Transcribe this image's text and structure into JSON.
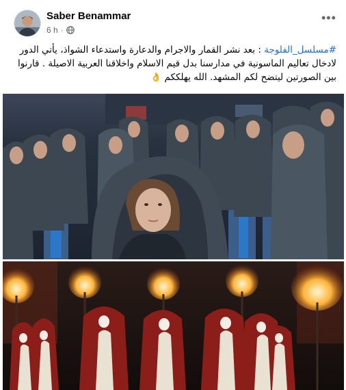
{
  "post": {
    "author": "Saber Benammar",
    "time": "6 h",
    "time_sep": "·",
    "hashtag": "#مسلسل_الفلوجة",
    "body": " : بعد نشر القمار والاجرام والدعارة واستدعاء الشواذ، يأتي الدور لادخال تعاليم الماسونية في مدارسنا بدل قيم الاسلام واخلاقنا العربية الاصيلة . قارنوا بين الصورتين ليتضح لكم المشهد. الله يهلككم",
    "emoji": "👌",
    "more_label": "•••"
  },
  "icons": {
    "privacy": "globe-icon",
    "options": "more-options-icon"
  },
  "colors": {
    "hashtag": "#216fdb",
    "author": "#050505",
    "meta": "#65676b"
  }
}
